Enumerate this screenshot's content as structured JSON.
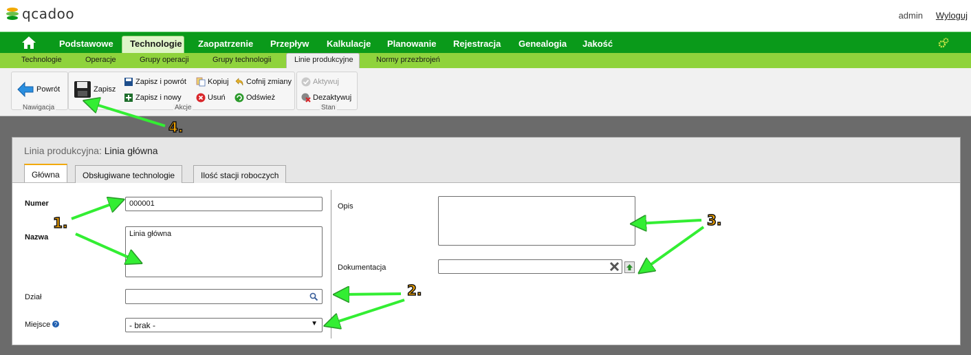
{
  "header": {
    "app_name": "qcadoo",
    "user": "admin",
    "logout": "Wyloguj"
  },
  "main_nav": {
    "items": [
      "Podstawowe",
      "Technologie",
      "Zaopatrzenie",
      "Przepływ",
      "Kalkulacje",
      "Planowanie",
      "Rejestracja",
      "Genealogia",
      "Jakość"
    ],
    "selected": "Technologie"
  },
  "sub_nav": {
    "items": [
      "Technologie",
      "Operacje",
      "Grupy operacji",
      "Grupy technologii",
      "Linie produkcyjne",
      "Normy przezbrojeń"
    ],
    "selected": "Linie produkcyjne"
  },
  "ribbon": {
    "nav_group": "Nawigacja",
    "actions_group": "Akcje",
    "state_group": "Stan",
    "back": "Powrót",
    "save": "Zapisz",
    "save_back": "Zapisz i powrót",
    "save_new": "Zapisz i nowy",
    "copy": "Kopiuj",
    "delete": "Usuń",
    "undo": "Cofnij zmiany",
    "refresh": "Odśwież",
    "activate": "Aktywuj",
    "deactivate": "Dezaktywuj"
  },
  "panel": {
    "title_prefix": "Linia produkcyjna:",
    "title_value": "Linia główna",
    "tabs": [
      "Główna",
      "Obsługiwane technologie",
      "Ilość stacji roboczych"
    ],
    "selected_tab": "Główna"
  },
  "form": {
    "number_label": "Numer",
    "number_value": "000001",
    "name_label": "Nazwa",
    "name_value": "Linia główna",
    "dept_label": "Dział",
    "dept_value": "",
    "place_label": "Miejsce",
    "place_value": "- brak -",
    "desc_label": "Opis",
    "desc_value": "",
    "doc_label": "Dokumentacja",
    "doc_value": ""
  },
  "annotations": [
    "1.",
    "2.",
    "3.",
    "4."
  ],
  "colors": {
    "nav_green": "#0a9a1a",
    "subnav_green": "#8fd33c",
    "arrow_green": "#33ee33",
    "annot_orange": "#f7a600"
  }
}
